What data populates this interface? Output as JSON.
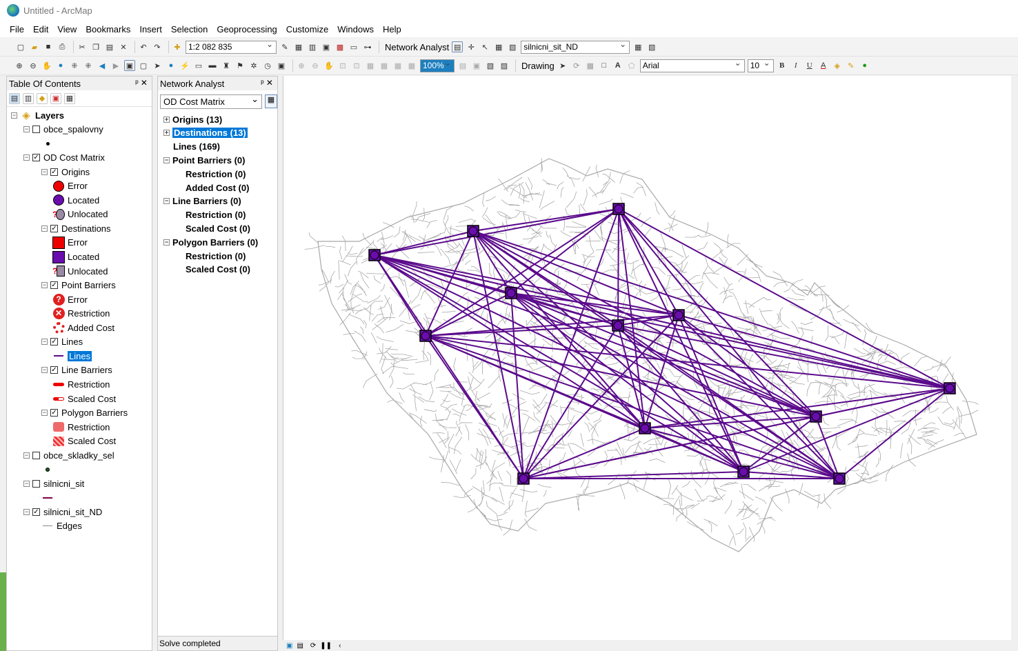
{
  "window": {
    "title": "Untitled - ArcMap"
  },
  "menu": [
    "File",
    "Edit",
    "View",
    "Bookmarks",
    "Insert",
    "Selection",
    "Geoprocessing",
    "Customize",
    "Windows",
    "Help"
  ],
  "toolbar1": {
    "scale": "1:2 082 835",
    "network_analyst_label": "Network Analyst",
    "network_dataset": "silnicni_sit_ND"
  },
  "toolbar2": {
    "drawing_label": "Drawing",
    "font": "Arial",
    "font_size": "10",
    "zoom_percent": "100%"
  },
  "toc": {
    "title": "Table Of Contents",
    "rows": [
      {
        "label": "Layers",
        "level": 0,
        "expander": "minus",
        "check": null,
        "symbol": "layers-icon",
        "bold": true
      },
      {
        "label": "obce_spalovny",
        "level": 1,
        "expander": "minus",
        "check": false,
        "symbol": null
      },
      {
        "label": "",
        "level": 2,
        "expander": null,
        "check": null,
        "symbol": "dot-icon"
      },
      {
        "label": "OD Cost Matrix",
        "level": 1,
        "expander": "minus",
        "check": true,
        "symbol": null
      },
      {
        "label": "Origins",
        "level": 2,
        "expander": "minus",
        "check": true,
        "symbol": null
      },
      {
        "label": "Error",
        "level": 3,
        "expander": null,
        "check": null,
        "symbol": "red-circle-icon"
      },
      {
        "label": "Located",
        "level": 3,
        "expander": null,
        "check": null,
        "symbol": "purple-circle-icon"
      },
      {
        "label": "Unlocated",
        "level": 3,
        "expander": null,
        "check": null,
        "symbol": "unlocated-circle-icon"
      },
      {
        "label": "Destinations",
        "level": 2,
        "expander": "minus",
        "check": true,
        "symbol": null
      },
      {
        "label": "Error",
        "level": 3,
        "expander": null,
        "check": null,
        "symbol": "red-square-icon"
      },
      {
        "label": "Located",
        "level": 3,
        "expander": null,
        "check": null,
        "symbol": "purple-square-icon"
      },
      {
        "label": "Unlocated",
        "level": 3,
        "expander": null,
        "check": null,
        "symbol": "unlocated-square-icon"
      },
      {
        "label": "Point Barriers",
        "level": 2,
        "expander": "minus",
        "check": true,
        "symbol": null
      },
      {
        "label": "Error",
        "level": 3,
        "expander": null,
        "check": null,
        "symbol": "question-icon"
      },
      {
        "label": "Restriction",
        "level": 3,
        "expander": null,
        "check": null,
        "symbol": "x-circle-icon"
      },
      {
        "label": "Added Cost",
        "level": 3,
        "expander": null,
        "check": null,
        "symbol": "ring-icon"
      },
      {
        "label": "Lines",
        "level": 2,
        "expander": "minus",
        "check": true,
        "symbol": null
      },
      {
        "label": "Lines",
        "level": 3,
        "expander": null,
        "check": null,
        "symbol": "purple-line-icon",
        "selected": true
      },
      {
        "label": "Line Barriers",
        "level": 2,
        "expander": "minus",
        "check": true,
        "symbol": null
      },
      {
        "label": "Restriction",
        "level": 3,
        "expander": null,
        "check": null,
        "symbol": "red-line-icon"
      },
      {
        "label": "Scaled Cost",
        "level": 3,
        "expander": null,
        "check": null,
        "symbol": "red-dashed-line-icon"
      },
      {
        "label": "Polygon Barriers",
        "level": 2,
        "expander": "minus",
        "check": true,
        "symbol": null
      },
      {
        "label": "Restriction",
        "level": 3,
        "expander": null,
        "check": null,
        "symbol": "red-polygon-icon"
      },
      {
        "label": "Scaled Cost",
        "level": 3,
        "expander": null,
        "check": null,
        "symbol": "hatched-polygon-icon"
      },
      {
        "label": "obce_skladky_sel",
        "level": 1,
        "expander": "minus",
        "check": false,
        "symbol": null
      },
      {
        "label": "",
        "level": 2,
        "expander": null,
        "check": null,
        "symbol": "green-dot-icon"
      },
      {
        "label": "silnicni_sit",
        "level": 1,
        "expander": "minus",
        "check": false,
        "symbol": null
      },
      {
        "label": "",
        "level": 2,
        "expander": null,
        "check": null,
        "symbol": "maroon-line-icon"
      },
      {
        "label": "silnicni_sit_ND",
        "level": 1,
        "expander": "minus",
        "check": true,
        "symbol": null
      },
      {
        "label": "Edges",
        "level": 2,
        "expander": null,
        "check": null,
        "symbol": "grey-line-icon"
      }
    ]
  },
  "na": {
    "title": "Network Analyst",
    "layer": "OD Cost Matrix",
    "status": "Solve completed",
    "rows": [
      {
        "label": "Origins (13)",
        "level": 0,
        "expander": "plus"
      },
      {
        "label": "Destinations (13)",
        "level": 0,
        "expander": "plus",
        "selected": true
      },
      {
        "label": "Lines (169)",
        "level": 0,
        "expander": null
      },
      {
        "label": "Point Barriers (0)",
        "level": 0,
        "expander": "minus"
      },
      {
        "label": "Restriction (0)",
        "level": 1,
        "expander": null
      },
      {
        "label": "Added Cost (0)",
        "level": 1,
        "expander": null
      },
      {
        "label": "Line Barriers (0)",
        "level": 0,
        "expander": "minus"
      },
      {
        "label": "Restriction (0)",
        "level": 1,
        "expander": null
      },
      {
        "label": "Scaled Cost (0)",
        "level": 1,
        "expander": null
      },
      {
        "label": "Polygon Barriers (0)",
        "level": 0,
        "expander": "minus"
      },
      {
        "label": "Restriction (0)",
        "level": 1,
        "expander": null
      },
      {
        "label": "Scaled Cost (0)",
        "level": 1,
        "expander": null
      }
    ]
  },
  "colors": {
    "route": "#5b0a8c",
    "point": "#6a0dad",
    "network": "#a8a8a8",
    "selection": "#0078d7"
  }
}
